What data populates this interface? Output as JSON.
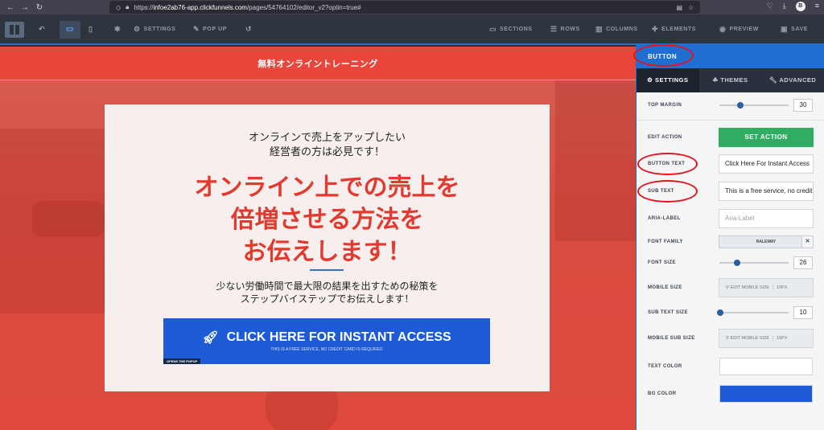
{
  "browser": {
    "url_prefix": "https://",
    "url_domain": "infoe2ab76-app.clickfunnels.com",
    "url_path": "/pages/54764102/editor_v2?optin=true#",
    "profile_initial": "B"
  },
  "toolbar": {
    "settings": "SETTINGS",
    "popup": "POP UP",
    "sections": "SECTIONS",
    "rows": "ROWS",
    "columns": "COLUMNS",
    "elements": "ELEMENTS",
    "preview": "PREVIEW",
    "save": "SAVE"
  },
  "page": {
    "header_title": "無料オンライントレーニング",
    "lead_line1": "オンラインで売上をアップしたい",
    "lead_line2": "経営者の方は必見です！",
    "headline_line1": "オンライン上での売上を",
    "headline_line2": "倍増させる方法を",
    "headline_line3": "お伝えします！",
    "sub_line1": "少ない労働時間で最大限の結果を出すための秘策を",
    "sub_line2": "ステップバイステップでお伝えします！",
    "cta_text": "CLICK HERE FOR INSTANT ACCESS",
    "cta_subtext": "THIS IS A FREE SERVICE, NO CREDIT CARD IS REQUIRED",
    "popup_tag": "OPENS THE POPUP"
  },
  "panel": {
    "title": "BUTTON",
    "tabs": [
      "SETTINGS",
      "THEMES",
      "ADVANCED"
    ],
    "top_margin_label": "TOP MARGIN",
    "top_margin_value": "30",
    "top_margin_level": 0.3,
    "edit_action_label": "EDIT ACTION",
    "set_action": "SET ACTION",
    "button_text_label": "BUTTON TEXT",
    "button_text_value": "Click Here For Instant Access",
    "sub_text_label": "SUB TEXT",
    "sub_text_value": "This is a free service, no credit card is required",
    "aria_label_label": "ARIA-LABEL",
    "aria_label_placeholder": "Aria-Label",
    "font_family_label": "FONT FAMILY",
    "font_family_value": "RALEWAY",
    "font_size_label": "FONT SIZE",
    "font_size_value": "26",
    "mobile_size_label": "MOBILE SIZE",
    "mobile_size_button": "EDIT MOBILE SIZE",
    "mobile_size_value": "10PX",
    "sub_text_size_label": "SUB TEXT SIZE",
    "sub_text_size_value": "10",
    "mobile_sub_label": "MOBILE SUB SIZE",
    "mobile_sub_button": "EDIT MOBILE SIZE",
    "mobile_sub_value": "10PX",
    "text_color_label": "TEXT COLOR",
    "text_color": "#ffffff",
    "bg_color_label": "BG COLOR",
    "bg_color": "#1c5ad6"
  }
}
